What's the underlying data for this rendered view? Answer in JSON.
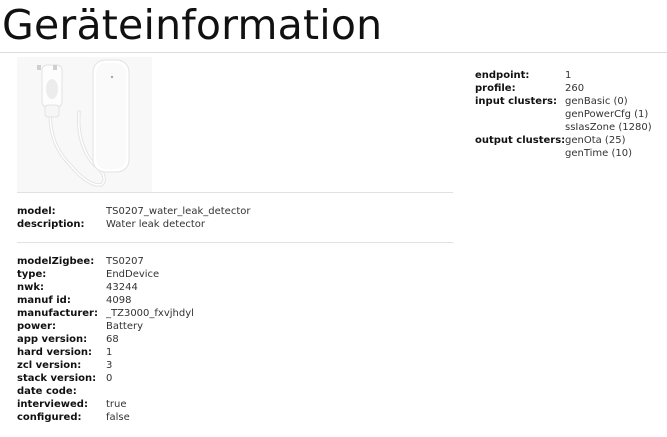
{
  "page": {
    "title": "Geräteinformation"
  },
  "device_image": {
    "icon": "water-leak-sensor-image"
  },
  "basic": [
    {
      "key": "model:",
      "value": "TS0207_water_leak_detector",
      "link": true
    },
    {
      "key": "description:",
      "value": "Water leak detector",
      "link": false
    }
  ],
  "details": [
    {
      "key": "modelZigbee:",
      "value": "TS0207"
    },
    {
      "key": "type:",
      "value": "EndDevice"
    },
    {
      "key": "nwk:",
      "value": "43244"
    },
    {
      "key": "manuf id:",
      "value": "4098"
    },
    {
      "key": "manufacturer:",
      "value": "_TZ3000_fxvjhdyl"
    },
    {
      "key": "power:",
      "value": "Battery"
    },
    {
      "key": "app version:",
      "value": "68"
    },
    {
      "key": "hard version:",
      "value": "1"
    },
    {
      "key": "zcl version:",
      "value": "3"
    },
    {
      "key": "stack version:",
      "value": "0"
    },
    {
      "key": "date code:",
      "value": ""
    },
    {
      "key": "interviewed:",
      "value": "true"
    },
    {
      "key": "configured:",
      "value": "false"
    }
  ],
  "endpoint": {
    "endpoint_label": "endpoint:",
    "endpoint_value": "1",
    "profile_label": "profile:",
    "profile_value": "260",
    "input_label": "input clusters:",
    "input_clusters": [
      "genBasic (0)",
      "genPowerCfg (1)",
      "ssIasZone (1280)"
    ],
    "output_label": "output clusters:",
    "output_clusters": [
      "genOta (25)",
      "genTime (10)"
    ]
  }
}
